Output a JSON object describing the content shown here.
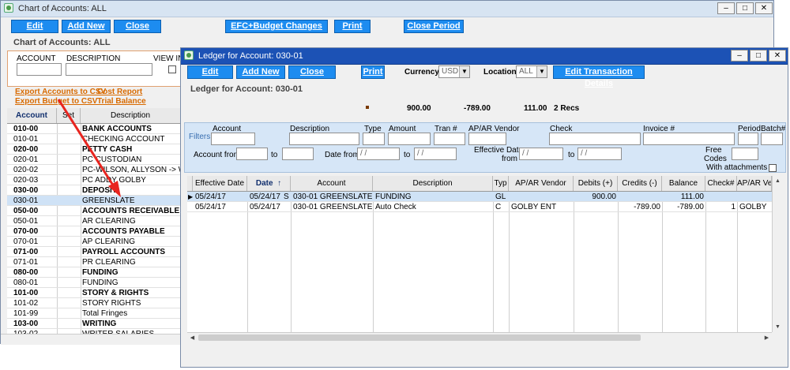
{
  "coa": {
    "title": "Chart of Accounts: ALL",
    "heading": "Chart of Accounts: ALL",
    "toolbar": {
      "edit": "Edit",
      "add_new": "Add New",
      "close": "Close",
      "efc": "EFC+Budget Changes",
      "print": "Print",
      "close_period": "Close Period"
    },
    "filters": {
      "account_label": "ACCOUNT",
      "description_label": "DESCRIPTION",
      "view_label": "VIEW IN"
    },
    "links": {
      "export_accounts": "Export Accounts to CSV",
      "export_budget": "Export Budget to CSV",
      "cost_report": "Cost Report",
      "trial_balance": "Trial Balance"
    },
    "columns": {
      "account": "Account",
      "set": "Set",
      "description": "Description"
    },
    "rows": [
      {
        "account": "010-00",
        "description": "BANK ACCOUNTS",
        "bold": true
      },
      {
        "account": "010-01",
        "description": "CHECKING ACCOUNT",
        "bold": false
      },
      {
        "account": "020-00",
        "description": "PETTY CASH",
        "bold": true
      },
      {
        "account": "020-01",
        "description": "PC CUSTODIAN",
        "bold": false
      },
      {
        "account": "020-02",
        "description": "PC-WILSON, ALLYSON -> WILSO",
        "bold": false
      },
      {
        "account": "020-03",
        "description": "PC ADDY GOLBY",
        "bold": false
      },
      {
        "account": "030-00",
        "description": "DEPOSIT",
        "bold": true
      },
      {
        "account": "030-01",
        "description": "GREENSLATE",
        "bold": false,
        "selected": true
      },
      {
        "account": "050-00",
        "description": "ACCOUNTS RECEIVABLE",
        "bold": true
      },
      {
        "account": "050-01",
        "description": "AR CLEARING",
        "bold": false
      },
      {
        "account": "070-00",
        "description": "ACCOUNTS PAYABLE",
        "bold": true
      },
      {
        "account": "070-01",
        "description": "AP CLEARING",
        "bold": false
      },
      {
        "account": "071-00",
        "description": "PAYROLL ACCOUNTS",
        "bold": true
      },
      {
        "account": "071-01",
        "description": "PR CLEARING",
        "bold": false
      },
      {
        "account": "080-00",
        "description": "FUNDING",
        "bold": true
      },
      {
        "account": "080-01",
        "description": "FUNDING",
        "bold": false
      },
      {
        "account": "101-00",
        "description": "STORY & RIGHTS",
        "bold": true
      },
      {
        "account": "101-02",
        "description": "STORY RIGHTS",
        "bold": false
      },
      {
        "account": "101-99",
        "description": "Total Fringes",
        "bold": false
      },
      {
        "account": "103-00",
        "description": "WRITING",
        "bold": true
      },
      {
        "account": "103-02",
        "description": "WRITER SALARIES",
        "bold": false
      }
    ]
  },
  "ledger": {
    "title": "Ledger for Account: 030-01",
    "heading": "Ledger for Account: 030-01",
    "toolbar": {
      "edit": "Edit",
      "add_new": "Add New",
      "close": "Close",
      "print": "Print",
      "currency_label": "Currency",
      "currency_value": "USD",
      "location_label": "Location:",
      "location_value": "ALL",
      "edit_details": "Edit Transaction Details"
    },
    "summary": {
      "debits": "900.00",
      "credits": "-789.00",
      "balance": "111.00",
      "recs": "2 Recs"
    },
    "filters": {
      "title": "Filters",
      "account": "Account",
      "description": "Description",
      "type": "Type",
      "amount": "Amount",
      "tran": "Tran #",
      "apar_vendor": "AP/AR Vendor",
      "check": "Check",
      "invoice": "Invoice #",
      "period": "Period",
      "batch": "Batch#",
      "account_from": "Account from",
      "to": "to",
      "date_from": "Date from",
      "date_placeholder": " /  /",
      "effective_date_line1": "Effective Date",
      "effective_date_line2": "from",
      "free_codes_line1": "Free",
      "free_codes_line2": "Codes",
      "with_attachments": "With attachments"
    },
    "columns": {
      "effective_date": "Effective Date",
      "date": "Date",
      "account": "Account",
      "description": "Description",
      "typ": "Typ",
      "apar_vendor": "AP/AR Vendor",
      "debits": "Debits (+)",
      "credits": "Credits (-)",
      "balance": "Balance",
      "check": "Check#",
      "apar_vendor2": "AP/AR Ven"
    },
    "rows": [
      {
        "effective_date": "05/24/17",
        "date": "05/24/17",
        "flag": "S",
        "account": "030-01  GREENSLATE",
        "description": "FUNDING",
        "typ": "GL",
        "vendor": "",
        "debits": "900.00",
        "credits": "",
        "balance": "111.00",
        "check": "",
        "vendor2": "",
        "selected": true
      },
      {
        "effective_date": "05/24/17",
        "date": "05/24/17",
        "flag": "",
        "account": "030-01  GREENSLATE",
        "description": "Auto Check",
        "typ": "C",
        "vendor": "GOLBY ENT",
        "debits": "",
        "credits": "-789.00",
        "balance": "-789.00",
        "check": "1",
        "vendor2": "GOLBY",
        "selected": false
      }
    ]
  },
  "colors": {
    "button": "#1d8cf0",
    "active_title": "#1c52b5",
    "link": "#d86a00",
    "filter_panel": "#d6e6f7",
    "selected_row": "#cfe2f6",
    "arrow": "#e8251f"
  }
}
